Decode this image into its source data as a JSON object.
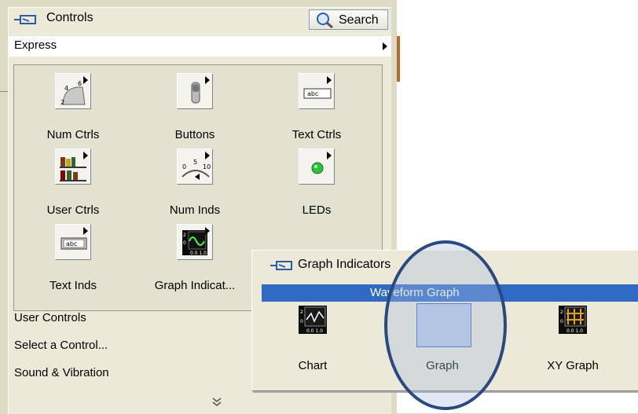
{
  "palette": {
    "title": "Controls",
    "search_label": "Search",
    "express_label": "Express",
    "items": [
      {
        "label": "Num Ctrls",
        "icon": "num-ctrls-icon"
      },
      {
        "label": "Buttons",
        "icon": "buttons-icon"
      },
      {
        "label": "Text Ctrls",
        "icon": "text-ctrls-icon"
      },
      {
        "label": "User Ctrls",
        "icon": "user-ctrls-icon"
      },
      {
        "label": "Num Inds",
        "icon": "num-inds-icon"
      },
      {
        "label": "LEDs",
        "icon": "leds-icon"
      },
      {
        "label": "Text Inds",
        "icon": "text-inds-icon"
      },
      {
        "label": "Graph Indicat...",
        "icon": "graph-indicators-icon"
      }
    ],
    "list": [
      "User Controls",
      "Select a Control...",
      "Sound & Vibration"
    ],
    "more_icon": "double-chevron-down-icon"
  },
  "graph_popup": {
    "title": "Graph Indicators",
    "tooltip": "Waveform Graph",
    "items": [
      {
        "label": "Chart",
        "icon": "chart-icon"
      },
      {
        "label": "Graph",
        "icon": "graph-icon"
      },
      {
        "label": "XY Graph",
        "icon": "xy-graph-icon"
      }
    ]
  }
}
